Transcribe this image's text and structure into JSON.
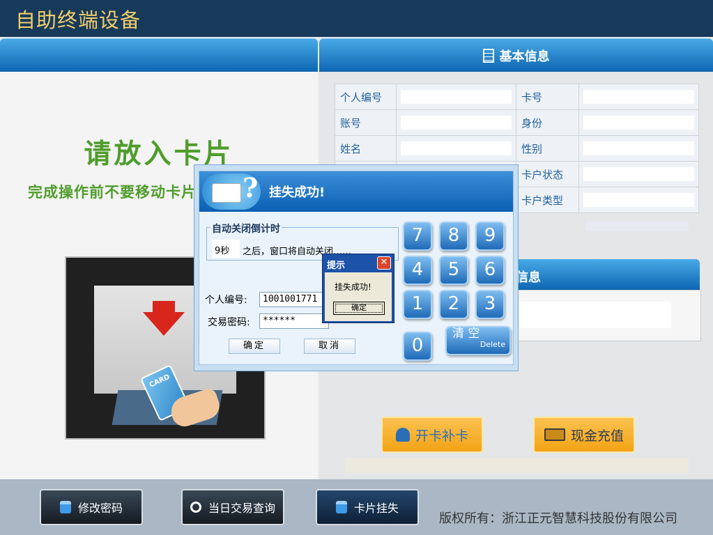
{
  "app": {
    "title": "自助终端设备"
  },
  "basic_info": {
    "header": "基本信息",
    "rows": [
      {
        "label_left": "个人编号",
        "label_right": "卡号"
      },
      {
        "label_left": "账号",
        "label_right": "身份"
      },
      {
        "label_left": "姓名",
        "label_right": "性别"
      },
      {
        "label_left": "",
        "label_right": "卡户状态"
      },
      {
        "label_left": "",
        "label_right": "卡户类型"
      }
    ]
  },
  "second_panel": {
    "header": "信息"
  },
  "insert_card": {
    "title": "请放入卡片",
    "subtitle": "完成操作前不要移动卡片",
    "card_text": "CARD"
  },
  "actions": {
    "open_card": "开卡补卡",
    "cash_recharge": "现金充值"
  },
  "footer": {
    "change_password": "修改密码",
    "daily_query": "当日交易查询",
    "report_lost": "卡片挂失",
    "copyright": "版权所有：浙江正元智慧科技股份有限公司"
  },
  "dialog": {
    "title": "挂失成功!",
    "countdown_label": "自动关闭倒计时",
    "countdown_seconds": "9秒",
    "countdown_message": "之后，窗口将自动关闭……",
    "person_id_label": "个人编号:",
    "person_id_value": "1001001771",
    "password_label": "交易密码:",
    "password_value": "******",
    "confirm": "确定",
    "cancel": "取消",
    "keypad": [
      "7",
      "8",
      "9",
      "4",
      "5",
      "6",
      "1",
      "2",
      "3",
      "0"
    ],
    "clear_label": "清 空",
    "clear_sub": "Delete"
  },
  "tip": {
    "title": "提示",
    "close": "✕",
    "message": "挂失成功!",
    "ok": "确定"
  }
}
